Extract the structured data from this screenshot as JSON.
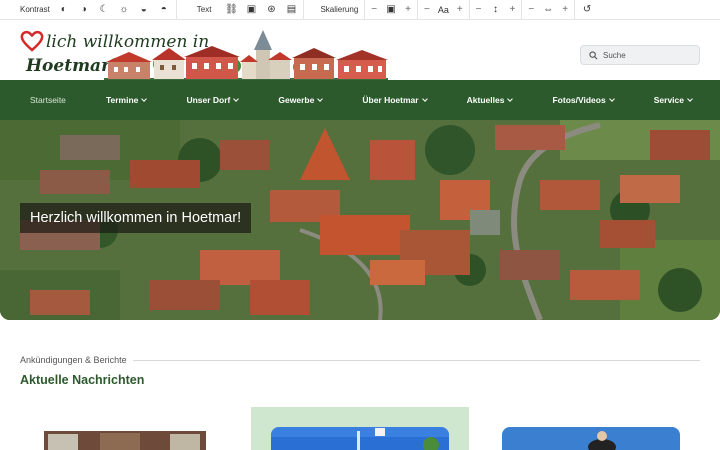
{
  "toolbar": {
    "contrast_label": "Kontrast",
    "text_label": "Text",
    "scale_label": "Skalierung",
    "font_label": "Aa",
    "minus": "−",
    "plus": "+"
  },
  "logo": {
    "line1": "lich willkommen in",
    "line2": "Hoetmar"
  },
  "search": {
    "placeholder": "Suche"
  },
  "nav": {
    "items": [
      {
        "label": "Startseite"
      },
      {
        "label": "Termine"
      },
      {
        "label": "Unser Dorf"
      },
      {
        "label": "Gewerbe"
      },
      {
        "label": "Über Hoetmar"
      },
      {
        "label": "Aktuelles"
      },
      {
        "label": "Fotos/Videos"
      },
      {
        "label": "Service"
      }
    ]
  },
  "hero": {
    "caption": "Herzlich willkommen in Hoetmar!"
  },
  "news": {
    "kicker": "Ankündigungen & Berichte",
    "title": "Aktuelle Nachrichten"
  },
  "colors": {
    "brand_green": "#2c5a2c",
    "heart_red": "#d42a2a"
  }
}
